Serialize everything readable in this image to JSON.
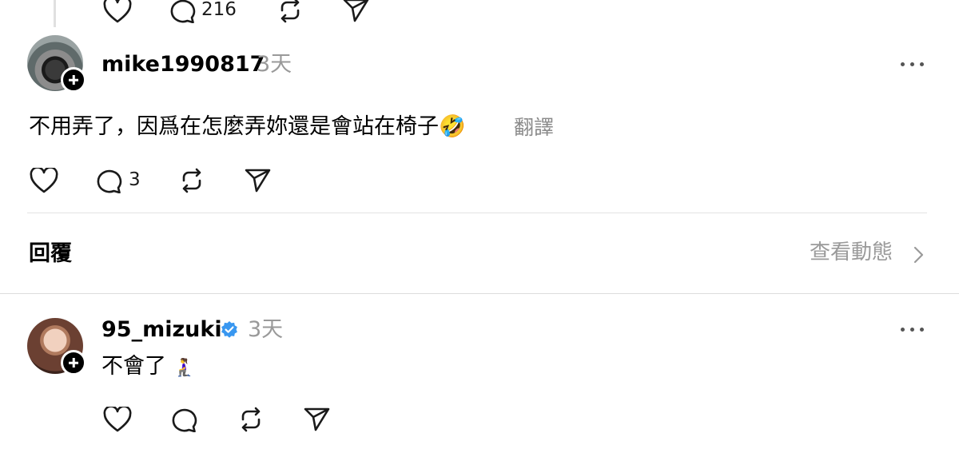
{
  "top_actions": {
    "comment_count": "216"
  },
  "reply1": {
    "username": "mike1990817",
    "time": "3天",
    "text": "不用弄了，因爲在怎麼弄妳還是會站在椅子",
    "emoji": "🤣",
    "translate_label": "翻譯",
    "comment_count": "3"
  },
  "section": {
    "title": "回覆",
    "activity_label": "查看動態"
  },
  "reply2": {
    "username": "95_mizuki",
    "time": "3天",
    "text": "不會了",
    "emoji": "🧎‍♀️",
    "verified": true
  },
  "colors": {
    "verified_blue": "#3897f0",
    "muted": "#999999"
  }
}
